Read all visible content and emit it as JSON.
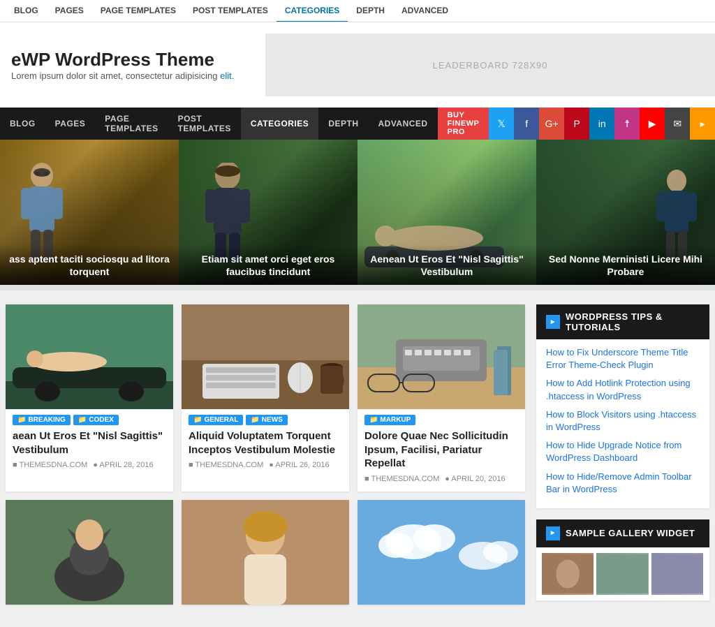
{
  "adminBar": {
    "tabs": [
      "BLOG",
      "PAGES",
      "PAGE TEMPLATES",
      "POST TEMPLATES",
      "CATEGORIES",
      "DEPTH",
      "ADVANCED"
    ],
    "activeTab": "CATEGORIES"
  },
  "siteHeader": {
    "title": "eWP WordPress Theme",
    "description": "Lorem ipsum dolor sit amet, consectetur adipisicing ",
    "descriptionLink": "elit.",
    "adLabel": "LEADERBOARD 728X90"
  },
  "mainNav": {
    "items": [
      "BLOG",
      "PAGES",
      "PAGE TEMPLATES",
      "POST TEMPLATES",
      "CATEGORIES",
      "DEPTH",
      "ADVANCED"
    ],
    "buyButton": "BUY FINEWP PRO",
    "socialIcons": [
      "twitter",
      "facebook",
      "google-plus",
      "pinterest",
      "linkedin",
      "instagram",
      "youtube",
      "mail",
      "rss"
    ]
  },
  "heroSlides": [
    {
      "caption": "ass aptent taciti sociosqu ad litora torquent",
      "bgClass": "slide-bg-1"
    },
    {
      "caption": "Etiam sit amet orci eget eros faucibus tincidunt",
      "bgClass": "slide-bg-2"
    },
    {
      "caption": "Aenean Ut Eros Et \"Nisl Sagittis\" Vestibulum",
      "bgClass": "slide-bg-3"
    },
    {
      "caption": "Sed Nonne Merninisti Licere Mihi Probare",
      "bgClass": "slide-bg-4"
    }
  ],
  "posts": [
    {
      "tags": [
        {
          "label": "BREAKING",
          "class": "tag-breaking"
        },
        {
          "label": "CODEX",
          "class": "tag-codex"
        }
      ],
      "title": "aean Ut Eros Et \"Nisl Sagittis\" Vestibulum",
      "meta": {
        "site": "THEMESDNA.COM",
        "date": "APRIL 28, 2016"
      },
      "imgClass": "img-car"
    },
    {
      "tags": [
        {
          "label": "GENERAL",
          "class": "tag-general"
        },
        {
          "label": "NEWS",
          "class": "tag-news"
        }
      ],
      "title": "Aliquid Voluptatem Torquent Inceptos Vestibulum Molestie",
      "meta": {
        "site": "THEMESDNA.COM",
        "date": "APRIL 26, 2016"
      },
      "imgClass": "img-desk"
    },
    {
      "tags": [
        {
          "label": "MARKUP",
          "class": "tag-markup"
        }
      ],
      "title": "Dolore Quae Nec Sollicitudin Ipsum, Facilisi, Pariatur Repellat",
      "meta": {
        "site": "THEMESDNA.COM",
        "date": "APRIL 20, 2016"
      },
      "imgClass": "img-typewriter"
    }
  ],
  "secondRowPosts": [
    {
      "imgClass": "img-cat",
      "showContent": false
    },
    {
      "imgClass": "img-girl",
      "showContent": false
    },
    {
      "imgClass": "img-sky",
      "showContent": false
    }
  ],
  "sidebar": {
    "widgets": [
      {
        "title": "WORDPRESS TIPS & TUTORIALS",
        "links": [
          "How to Fix Underscore Theme Title Error Theme-Check Plugin",
          "How to Add Hotlink Protection using .htaccess in WordPress",
          "How to Block Visitors using .htaccess in WordPress",
          "How to Hide Upgrade Notice from WordPress Dashboard",
          "How to Hide/Remove Admin Toolbar Bar in WordPress"
        ]
      },
      {
        "title": "SAMPLE GALLERY WIDGET",
        "links": []
      }
    ]
  }
}
